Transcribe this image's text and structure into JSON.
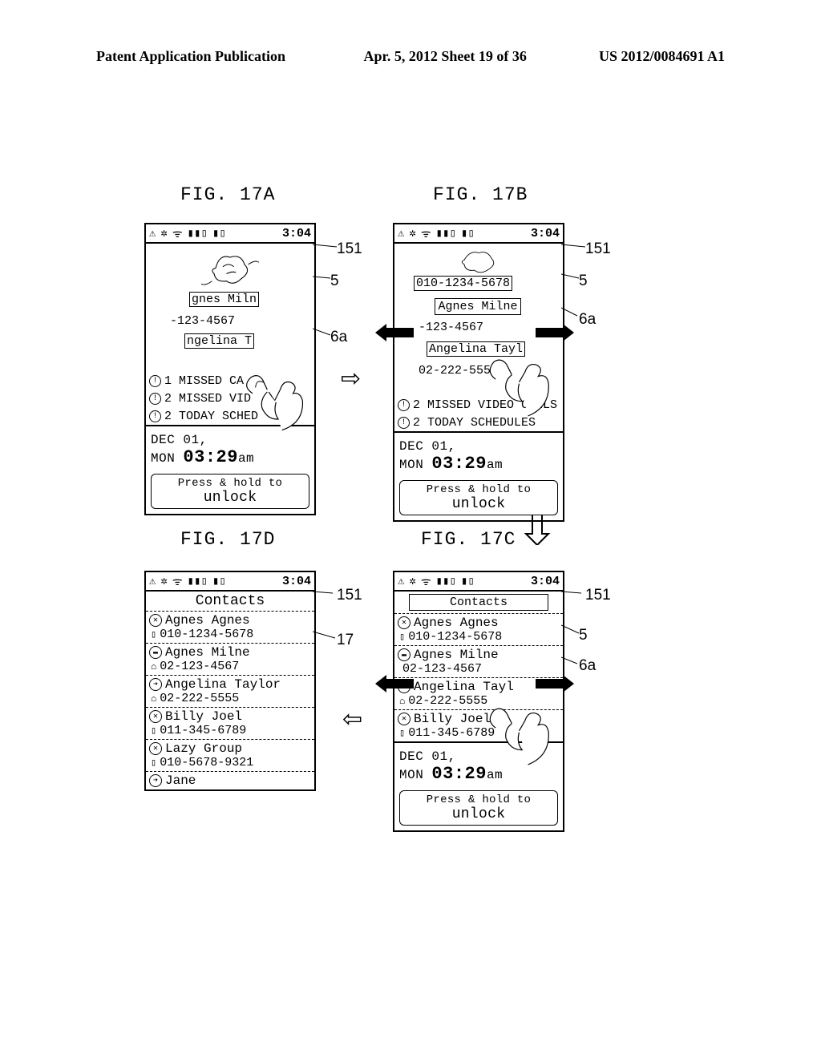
{
  "header": {
    "left": "Patent Application Publication",
    "mid": "Apr. 5, 2012  Sheet 19 of 36",
    "right": "US 2012/0084691 A1"
  },
  "figA": {
    "label": "FIG. 17A"
  },
  "figB": {
    "label": "FIG. 17B"
  },
  "figC": {
    "label": "FIG. 17C"
  },
  "figD": {
    "label": "FIG. 17D"
  },
  "leads": {
    "l151": "151",
    "l5": "5",
    "l6a": "6a",
    "l17": "17"
  },
  "status": {
    "time": "3:04"
  },
  "overlayA": {
    "box1": "gnes Miln",
    "t2": "-123-4567",
    "box3": "ngelina T"
  },
  "overlayB": {
    "box0": "010-1234-5678",
    "box1": "Agnes Milne",
    "t2": "-123-4567",
    "box3": "Angelina Tayl",
    "t4": "02-222-5555"
  },
  "alertsA": {
    "a1": "1 MISSED CA",
    "a2": "2 MISSED VID",
    "a3": "2 TODAY SCHED"
  },
  "alertsB": {
    "a2": "2 MISSED VIDEO CALLS",
    "a3": "2 TODAY SCHEDULES"
  },
  "dt": {
    "date": "DEC 01, MON",
    "time": "03:29",
    "ampm": "am"
  },
  "unlock": {
    "pre": "Press & hold to ",
    "word": "unlock"
  },
  "contacts_title": "Contacts",
  "contactsFull": [
    {
      "name": "Agnes Agnes",
      "phone": "010-1234-5678",
      "ci": "✕",
      "ti": "▯"
    },
    {
      "name": "Agnes Milne",
      "phone": "02-123-4567",
      "ci": "▬",
      "ti": "⌂"
    },
    {
      "name": "Angelina Taylor",
      "phone": "02-222-5555",
      "ci": "➔",
      "ti": "⌂"
    },
    {
      "name": "Billy Joel",
      "phone": "011-345-6789",
      "ci": "✕",
      "ti": "▯"
    },
    {
      "name": "Lazy Group",
      "phone": "010-5678-9321",
      "ci": "✕",
      "ti": "▯"
    },
    {
      "name": "Jane",
      "phone": "",
      "ci": "➔",
      "ti": ""
    }
  ],
  "contactsC": [
    {
      "name": "Agnes Agnes",
      "phone": "010-1234-5678",
      "ci": "✕",
      "ti": "▯"
    },
    {
      "name": "Agnes Milne",
      "phone": "02-123-4567",
      "ci": "▬",
      "ti": ""
    },
    {
      "name": "Angelina Tayl",
      "phone": "02-222-5555",
      "ci": "➔",
      "ti": "⌂"
    },
    {
      "name": "Billy Joel",
      "phone": "011-345-6789",
      "ci": "✕",
      "ti": "▯"
    }
  ]
}
